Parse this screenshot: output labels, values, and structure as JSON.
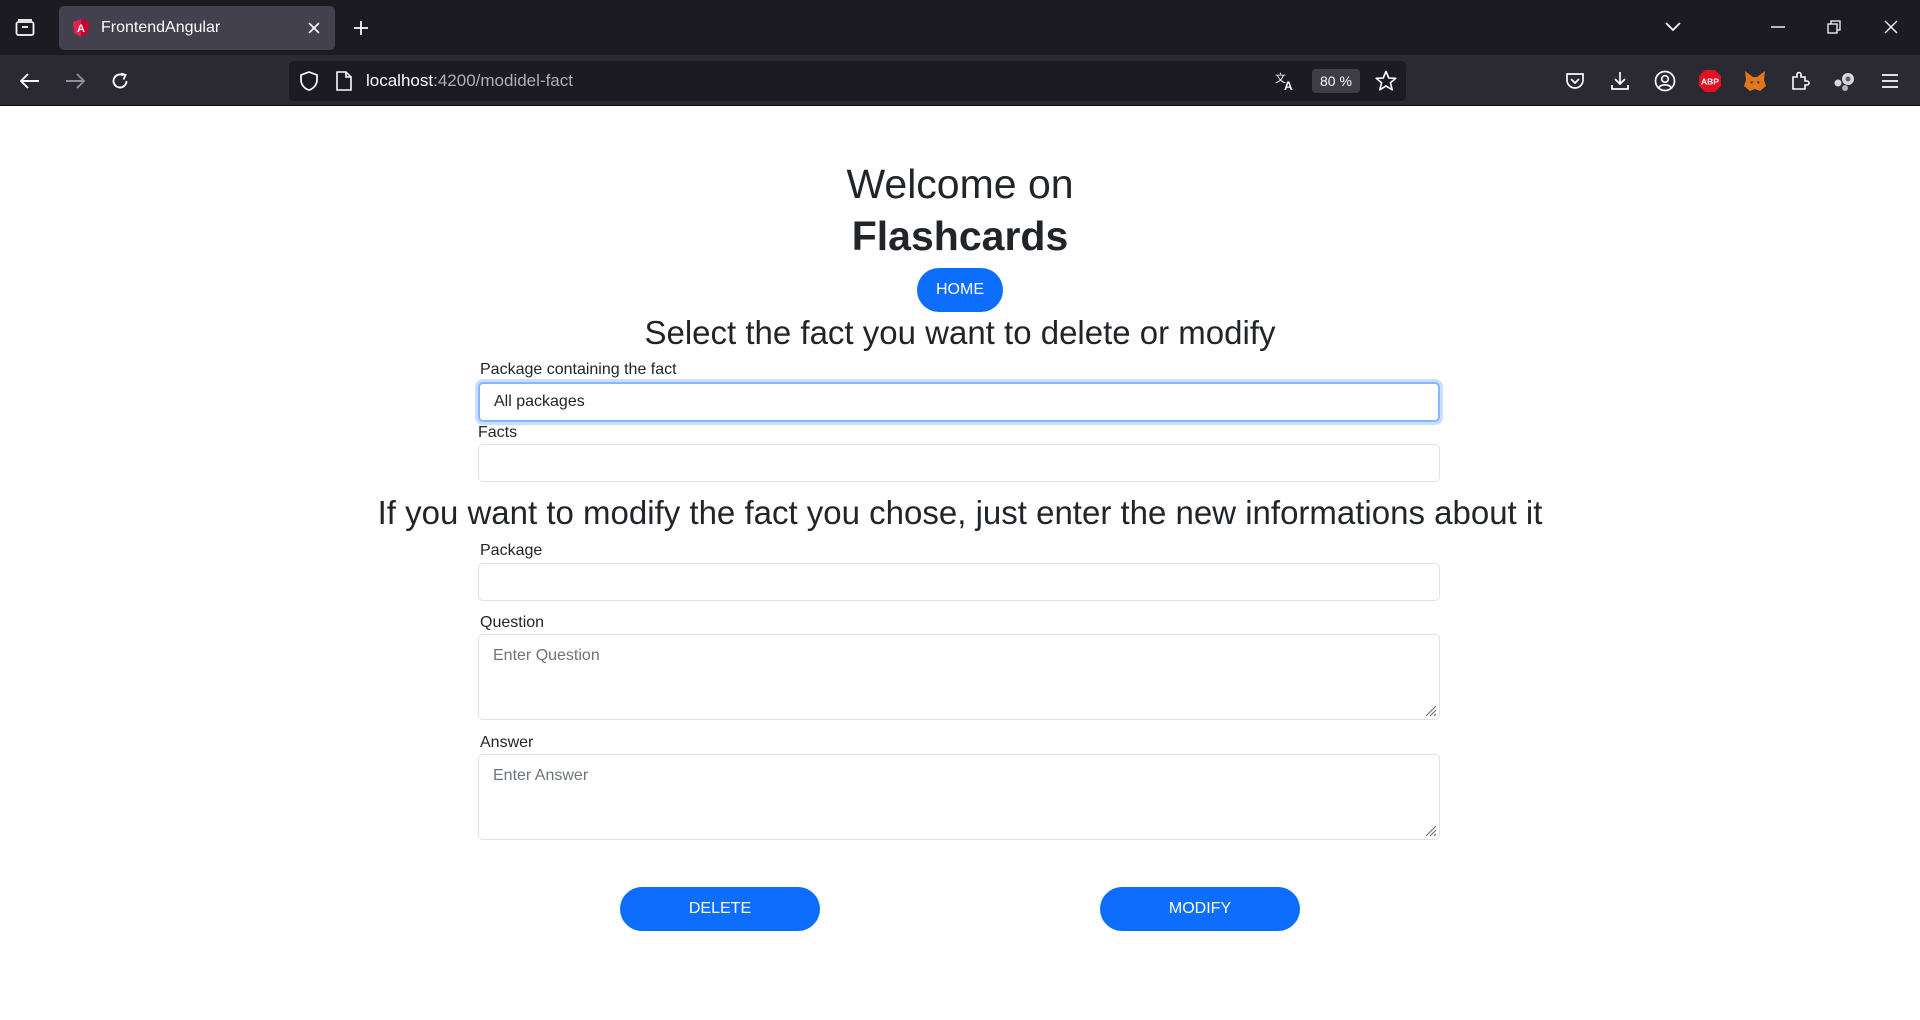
{
  "browser": {
    "tab_title": "FrontendAngular",
    "url_host": "localhost",
    "url_path": ":4200/modidel-fact",
    "zoom": "80 %"
  },
  "page": {
    "welcome": "Welcome on",
    "brand": "Flashcards",
    "home_button": "HOME",
    "select_heading": "Select the fact you want to delete or modify",
    "package_select_label": "Package containing the fact",
    "package_select_value": "All packages",
    "facts_label": "Facts",
    "facts_value": "",
    "modify_heading": "If you want to modify the fact you chose, just enter the new informations about it",
    "package_label": "Package",
    "package_value": "",
    "question_label": "Question",
    "question_placeholder": "Enter Question",
    "answer_label": "Answer",
    "answer_placeholder": "Enter Answer",
    "delete_button": "DELETE",
    "modify_button": "MODIFY"
  },
  "colors": {
    "primary": "#0d6efd",
    "chrome_dark": "#1c1b22",
    "toolbar": "#2b2a33"
  },
  "icons": [
    "tab-list-icon",
    "angular-favicon",
    "close-icon",
    "plus-icon",
    "chevron-down-icon",
    "minimize-icon",
    "restore-icon",
    "window-close-icon",
    "back-icon",
    "forward-icon",
    "reload-icon",
    "shield-icon",
    "page-icon",
    "translate-icon",
    "star-icon",
    "pocket-icon",
    "download-icon",
    "account-icon",
    "adblock-icon",
    "metamask-icon",
    "extensions-icon",
    "profile-icon",
    "menu-icon"
  ]
}
